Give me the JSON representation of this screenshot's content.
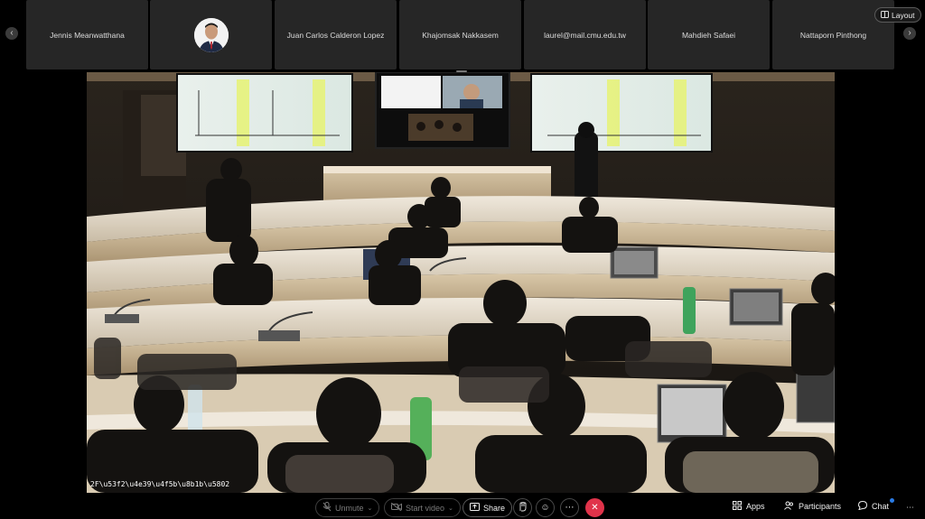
{
  "participants": [
    {
      "name": "Jennis Meanwatthana",
      "has_avatar": false
    },
    {
      "name": "",
      "has_avatar": true
    },
    {
      "name": "Juan Carlos Calderon Lopez",
      "has_avatar": false
    },
    {
      "name": "Khajomsak Nakkasem",
      "has_avatar": false
    },
    {
      "name": "laurel@mail.cmu.edu.tw",
      "has_avatar": false
    },
    {
      "name": "Mahdieh Safaei",
      "has_avatar": false
    },
    {
      "name": "Nattaporn Pinthong",
      "has_avatar": false
    }
  ],
  "layout_button": {
    "label": "Layout"
  },
  "main_video": {
    "caption": "2F\\u53f2\\u4e39\\u4f5b\\u8b1b\\u5802"
  },
  "toolbar": {
    "unmute": "Unmute",
    "start_video": "Start video",
    "share": "Share",
    "apps": "Apps",
    "participants": "Participants",
    "chat": "Chat"
  },
  "colors": {
    "tile_bg": "#262626",
    "end_call": "#e0334a",
    "chat_badge": "#2a7ce6"
  }
}
